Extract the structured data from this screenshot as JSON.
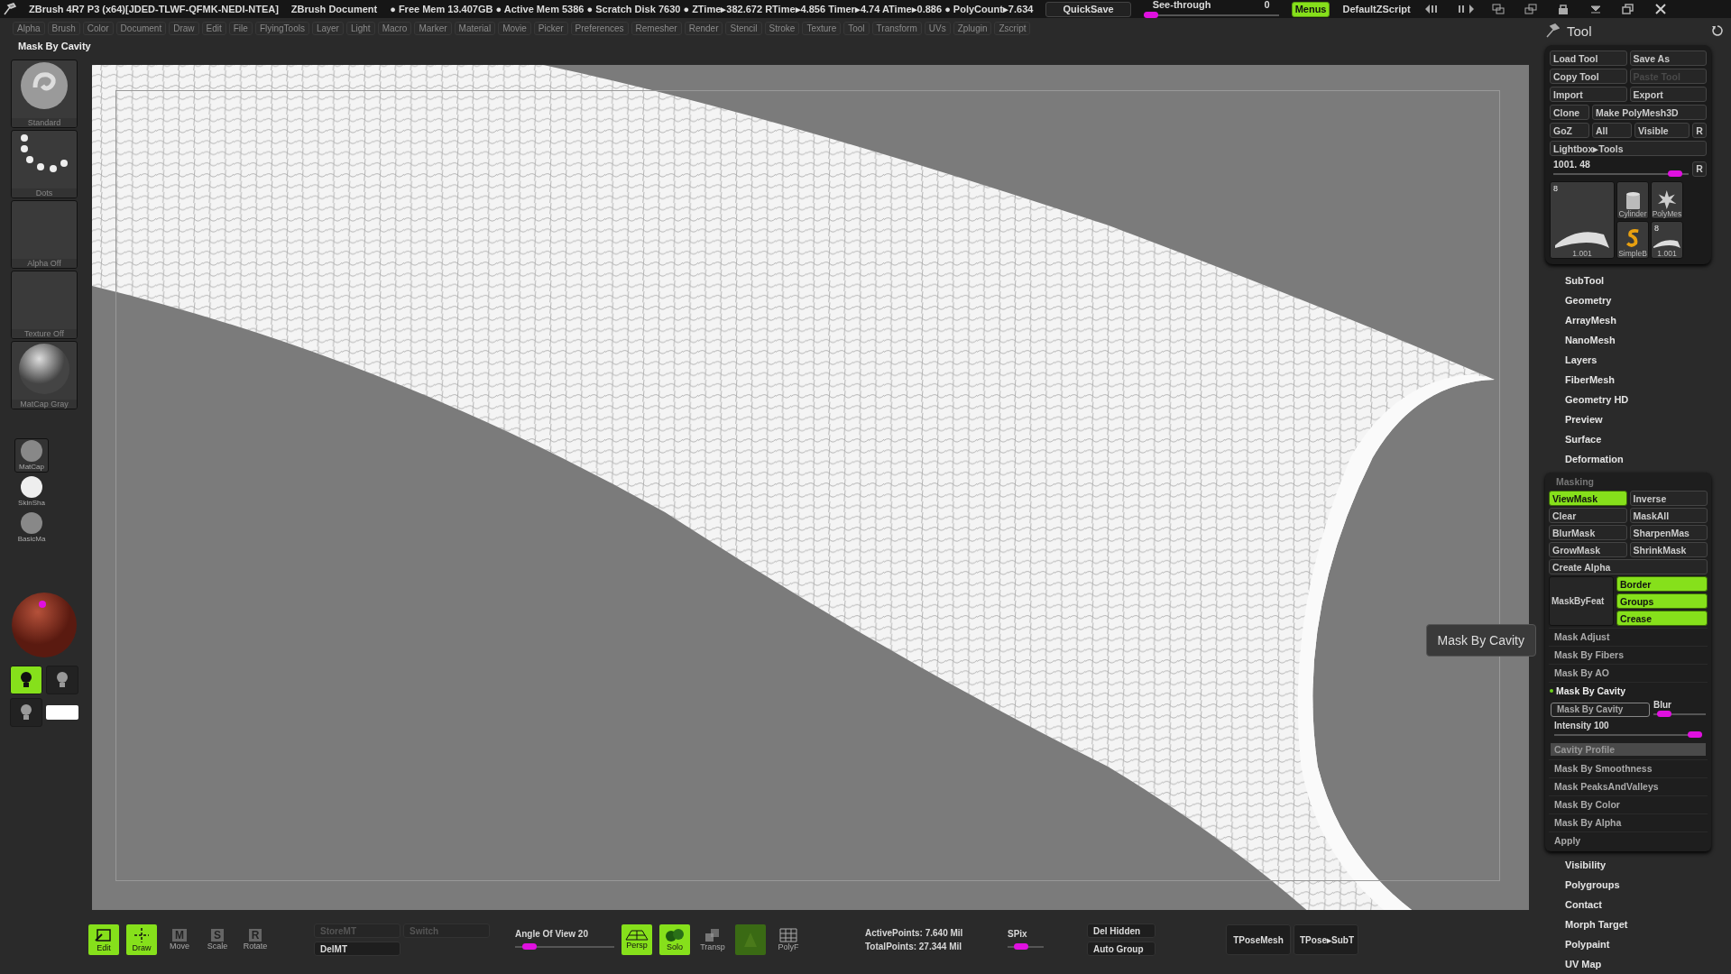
{
  "title_bar": {
    "app": "ZBrush 4R7 P3 (x64)[JDED-TLWF-QFMK-NEDI-NTEA]",
    "document": "ZBrush Document",
    "stats": "● Free Mem 13.407GB ● Active Mem 5386 ● Scratch Disk 7630 ● ZTime▸382.672 RTime▸4.856 Timer▸4.74 ATime▸0.886 ● PolyCount▸7.634",
    "quicksave": "QuickSave",
    "see_through": {
      "label": "See-through",
      "value": "0",
      "level": 0
    },
    "menus": {
      "label": "Menus",
      "on": true
    },
    "script": "DefaultZScript"
  },
  "menu_bar": [
    "Alpha",
    "Brush",
    "Color",
    "Document",
    "Draw",
    "Edit",
    "File",
    "FlyingTools",
    "Layer",
    "Light",
    "Macro",
    "Marker",
    "Material",
    "Movie",
    "Picker",
    "Preferences",
    "Remesher",
    "Render",
    "Stencil",
    "Stroke",
    "Texture",
    "Tool",
    "Transform",
    "UVs",
    "Zplugin",
    "Zscript"
  ],
  "status": "Mask By Cavity",
  "left_shelf": {
    "thumbnails": [
      {
        "label": "Standard",
        "kind": "brush"
      },
      {
        "label": "Dots",
        "kind": "stroke"
      },
      {
        "label": "Alpha  Off",
        "kind": "empty"
      },
      {
        "label": "Texture  Off",
        "kind": "empty"
      },
      {
        "label": "MatCap  Gray",
        "kind": "material"
      }
    ],
    "materials": [
      {
        "label": "MatCap",
        "selected": true
      },
      {
        "label": "SkinSha",
        "selected": false
      },
      {
        "label": "BasicMa",
        "selected": false
      }
    ],
    "lights": [
      {
        "selected": true
      },
      {
        "selected": false
      },
      {
        "selected": false
      }
    ]
  },
  "viewport": {
    "tooltip": "Mask By Cavity"
  },
  "tool_palette": {
    "title": "Tool",
    "button_rows": [
      [
        {
          "label": "Load Tool",
          "disabled": false
        },
        {
          "label": "Save As",
          "disabled": false
        }
      ],
      [
        {
          "label": "Copy Tool",
          "disabled": false
        },
        {
          "label": "Paste Tool",
          "disabled": true
        }
      ],
      [
        {
          "label": "Import",
          "disabled": false
        },
        {
          "label": "Export",
          "disabled": false
        }
      ],
      [
        {
          "label": "Clone",
          "disabled": false
        },
        {
          "label": "Make PolyMesh3D",
          "disabled": false
        }
      ],
      [
        {
          "label": "GoZ",
          "disabled": false
        },
        {
          "label": "All",
          "disabled": false
        },
        {
          "label": "Visible",
          "disabled": false
        },
        {
          "label": "R",
          "disabled": false
        }
      ],
      [
        {
          "label": "Lightbox▸Tools",
          "disabled": false
        }
      ]
    ],
    "slider": {
      "value": "1001. 48",
      "level": 0.95,
      "reset": "R"
    },
    "thumbnails": [
      {
        "kind": "mesh",
        "badge": "8",
        "label": "1.001"
      },
      {
        "kind": "cylinder",
        "label": "Cylinder"
      },
      {
        "kind": "star",
        "label": "PolyMes"
      },
      {
        "kind": "spiral",
        "label": "SimpleB"
      },
      {
        "kind": "mesh",
        "badge": "8",
        "label": "1.001"
      }
    ],
    "sections": [
      "SubTool",
      "Geometry",
      "ArrayMesh",
      "NanoMesh",
      "Layers",
      "FiberMesh",
      "Geometry HD",
      "Preview",
      "Surface",
      "Deformation"
    ],
    "masking": {
      "title": "Masking",
      "button_rows": [
        [
          {
            "label": "ViewMask",
            "on": true
          },
          {
            "label": "Inverse",
            "on": false
          }
        ],
        [
          {
            "label": "Clear",
            "on": false
          },
          {
            "label": "MaskAll",
            "on": false
          }
        ],
        [
          {
            "label": "BlurMask",
            "on": false
          },
          {
            "label": "SharpenMas",
            "on": false
          }
        ],
        [
          {
            "label": "GrowMask",
            "on": false
          },
          {
            "label": "ShrinkMask",
            "on": false
          }
        ],
        [
          {
            "label": "Create Alpha",
            "on": false
          }
        ]
      ],
      "feature": {
        "label": "MaskByFeat",
        "toggles": [
          {
            "label": "Border",
            "on": true
          },
          {
            "label": "Groups",
            "on": true
          },
          {
            "label": "Crease",
            "on": true
          }
        ]
      },
      "subsections": [
        {
          "label": "Mask Adjust",
          "expanded": false
        },
        {
          "label": "Mask By Fibers",
          "expanded": false
        },
        {
          "label": "Mask By AO",
          "expanded": false
        },
        {
          "label": "Mask By Cavity",
          "expanded": true
        },
        {
          "label": "Mask By Smoothness",
          "expanded": false
        },
        {
          "label": "Mask PeaksAndValleys",
          "expanded": false
        },
        {
          "label": "Mask By Color",
          "expanded": false
        },
        {
          "label": "Mask By Alpha",
          "expanded": false
        }
      ],
      "cavity": {
        "button": "Mask By Cavity",
        "blur": {
          "label": "Blur",
          "level": 0.1
        },
        "intensity": {
          "label": "Intensity 100",
          "level": 1
        },
        "profile": "Cavity Profile"
      },
      "apply": "Apply"
    },
    "sections_after": [
      "Visibility",
      "Polygroups",
      "Contact",
      "Morph Target",
      "Polypaint",
      "UV Map"
    ]
  },
  "bottom_bar": {
    "tools": [
      {
        "label": "Edit",
        "kind": "edit",
        "on": true
      },
      {
        "label": "Draw",
        "kind": "draw",
        "on": true
      },
      {
        "label": "Move",
        "kind": "letter",
        "glyph": "M",
        "on": false
      },
      {
        "label": "Scale",
        "kind": "letter",
        "glyph": "S",
        "on": false
      },
      {
        "label": "Rotate",
        "kind": "letter",
        "glyph": "R",
        "on": false
      }
    ],
    "mt_buttons": [
      {
        "label": "StoreMT",
        "disabled": true
      },
      {
        "label": "Switch",
        "disabled": true
      },
      {
        "label": "DelMT",
        "disabled": false
      }
    ],
    "angle_of_view": {
      "label": "Angle Of View 20",
      "level": 0.08
    },
    "view_buttons": [
      {
        "label": "Persp",
        "kind": "persp",
        "on": true
      },
      {
        "label": "Solo",
        "kind": "solo",
        "on": true
      },
      {
        "label": "Transp",
        "kind": "transp",
        "on": false
      },
      {
        "kind": "ghost",
        "on": true
      },
      {
        "label": "PolyF",
        "kind": "polyf",
        "on": false
      }
    ],
    "points": [
      "ActivePoints: 7.640 Mil",
      "TotalPoints: 27.344 Mil"
    ],
    "spix": {
      "label": "SPix",
      "level": 0.3
    },
    "actions": [
      "Del Hidden",
      "Auto Group"
    ],
    "tpose": [
      "TPoseMesh",
      "TPose▸SubT"
    ]
  }
}
